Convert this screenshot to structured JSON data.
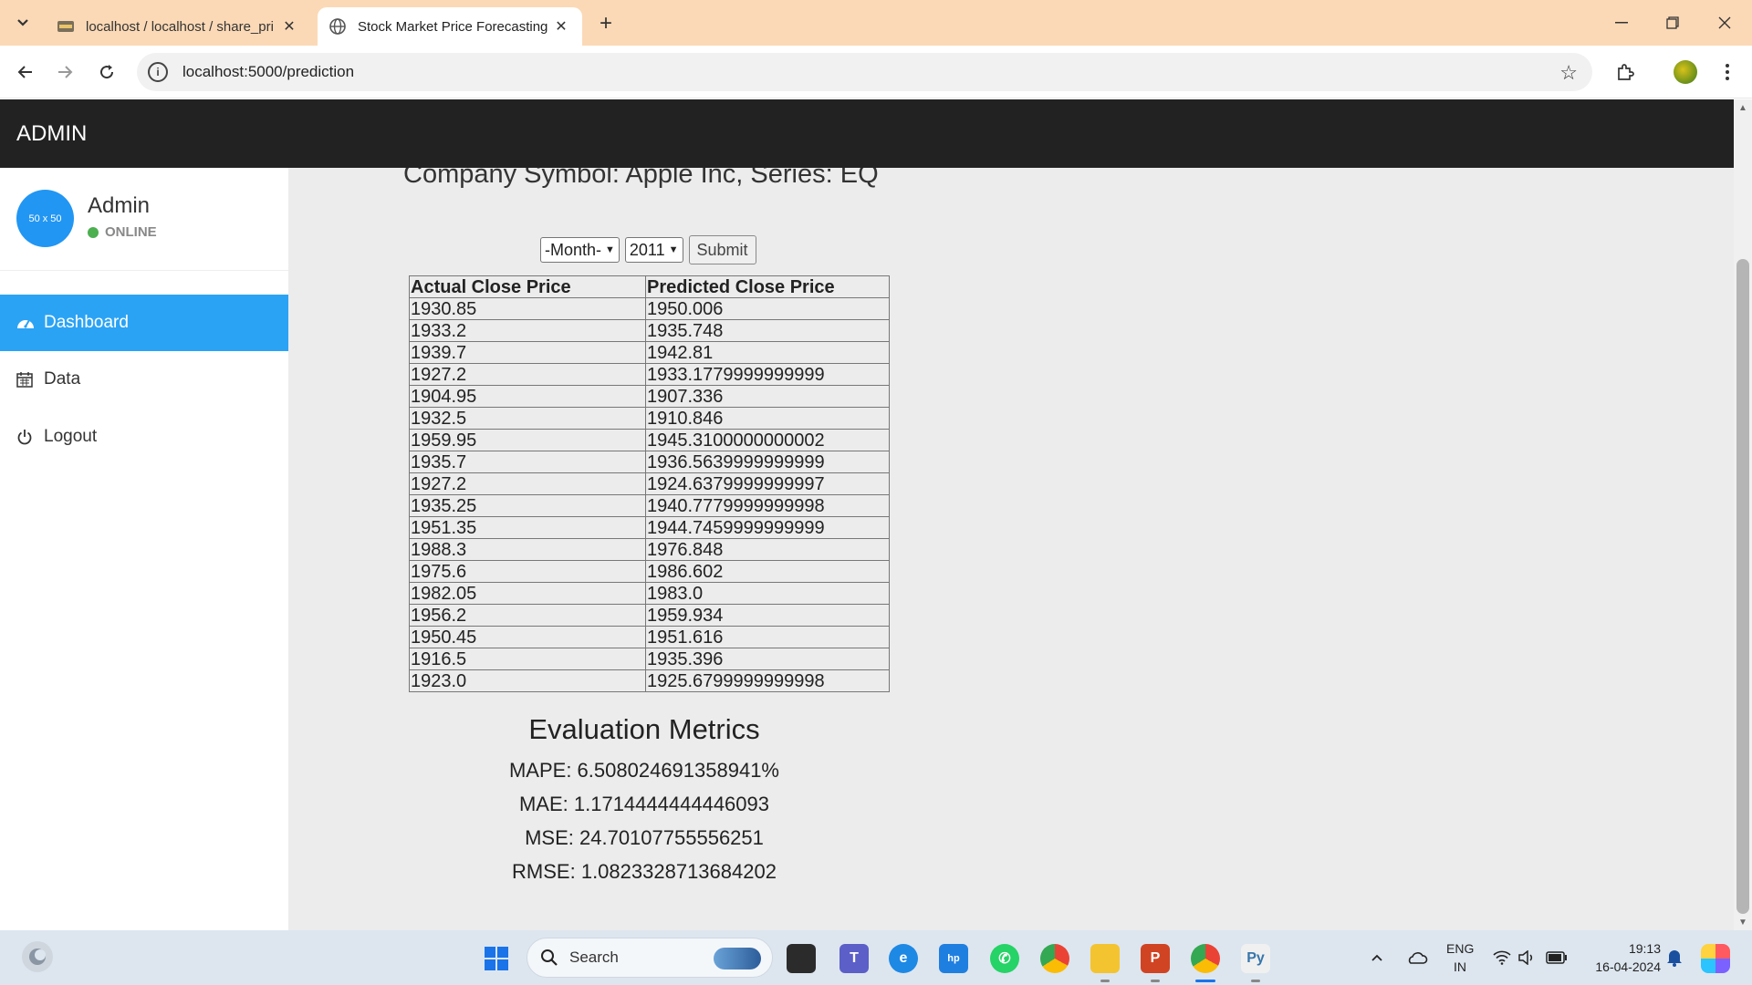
{
  "browser": {
    "tabs": [
      {
        "title": "localhost / localhost / share_pri",
        "active": false
      },
      {
        "title": "Stock Market Price Forecasting",
        "active": true
      }
    ],
    "url": "localhost:5000/prediction"
  },
  "header": {
    "brand": "ADMIN"
  },
  "sidebar": {
    "avatar_text": "50 x 50",
    "user_name": "Admin",
    "status": "ONLINE",
    "items": [
      {
        "label": "Dashboard",
        "icon": "dashboard-icon",
        "active": true
      },
      {
        "label": "Data",
        "icon": "calendar-icon",
        "active": false
      },
      {
        "label": "Logout",
        "icon": "power-icon",
        "active": false
      }
    ]
  },
  "main": {
    "company": "Company Symbol: Apple Inc, Series: EQ",
    "month_select": "-Month-",
    "year_select": "2011",
    "submit_label": "Submit",
    "columns": [
      "Actual Close Price",
      "Predicted Close Price"
    ],
    "rows": [
      [
        "1930.85",
        "1950.006"
      ],
      [
        "1933.2",
        "1935.748"
      ],
      [
        "1939.7",
        "1942.81"
      ],
      [
        "1927.2",
        "1933.1779999999999"
      ],
      [
        "1904.95",
        "1907.336"
      ],
      [
        "1932.5",
        "1910.846"
      ],
      [
        "1959.95",
        "1945.3100000000002"
      ],
      [
        "1935.7",
        "1936.5639999999999"
      ],
      [
        "1927.2",
        "1924.6379999999997"
      ],
      [
        "1935.25",
        "1940.7779999999998"
      ],
      [
        "1951.35",
        "1944.7459999999999"
      ],
      [
        "1988.3",
        "1976.848"
      ],
      [
        "1975.6",
        "1986.602"
      ],
      [
        "1982.05",
        "1983.0"
      ],
      [
        "1956.2",
        "1959.934"
      ],
      [
        "1950.45",
        "1951.616"
      ],
      [
        "1916.5",
        "1935.396"
      ],
      [
        "1923.0",
        "1925.6799999999998"
      ]
    ],
    "metrics_title": "Evaluation Metrics",
    "metrics": [
      "MAPE: 6.508024691358941%",
      "MAE: 1.1714444444446093",
      "MSE: 24.70107755556251",
      "RMSE: 1.0823328713684202"
    ]
  },
  "taskbar": {
    "search_placeholder": "Search",
    "lang_line1": "ENG",
    "lang_line2": "IN",
    "time": "19:13",
    "date": "16-04-2024"
  }
}
